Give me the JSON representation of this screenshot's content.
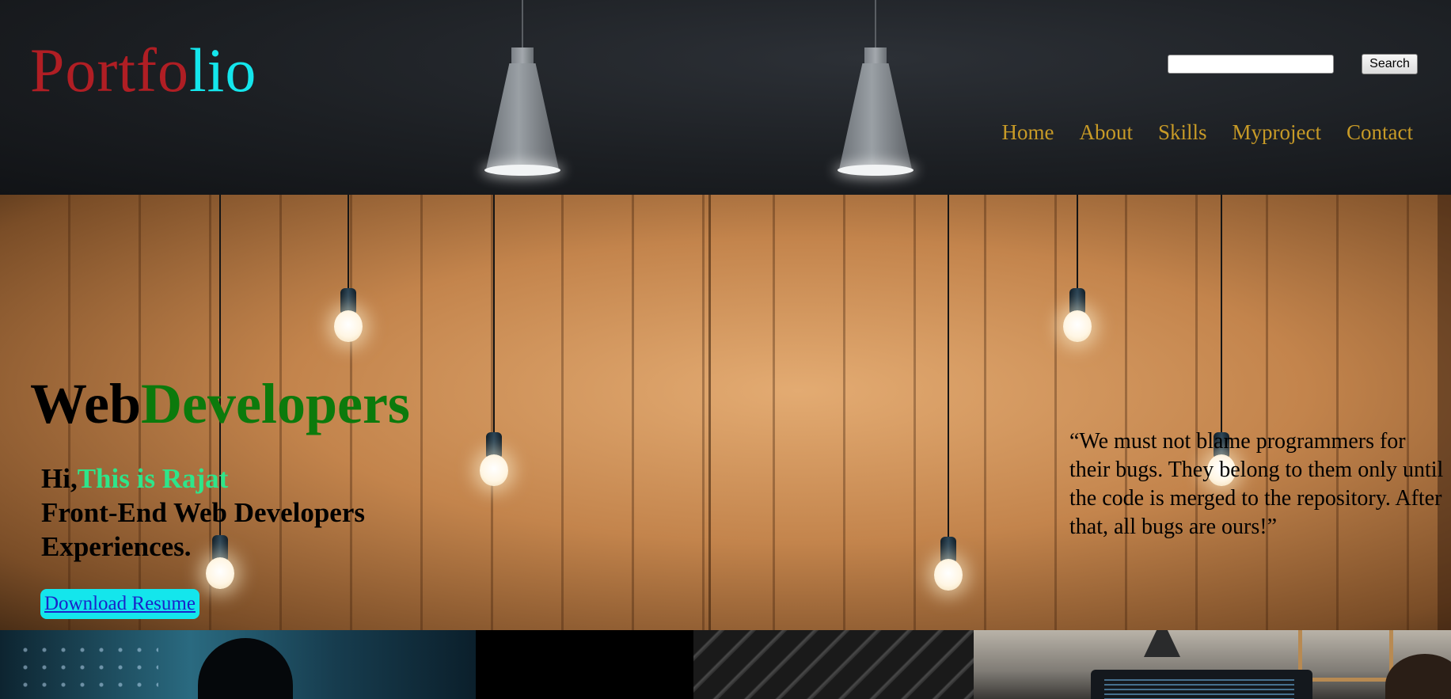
{
  "header": {
    "logo": {
      "part1": "Portfo",
      "part2": "lio"
    },
    "search": {
      "value": "",
      "placeholder": "",
      "button_label": "Search"
    },
    "nav": [
      "Home",
      "About",
      "Skills",
      "Myproject",
      "Contact"
    ]
  },
  "hero": {
    "title": {
      "part1": "Web",
      "part2": "Developers"
    },
    "greeting": "Hi,",
    "name": "This is Rajat",
    "role_line1": "Front-End Web Developers",
    "role_line2": "Experiences.",
    "download_label": "Download Resume",
    "quote": "“We must not blame programmers for their bugs. They belong to them only until the code is merged to the repository. After that, all bugs are ours!”"
  },
  "colors": {
    "logo_red": "#b01e24",
    "logo_cyan": "#14e6ec",
    "nav_gold": "#c79a27",
    "title_green": "#0c7a0c",
    "name_green": "#2ee58a",
    "button_cyan": "#14e6ec"
  }
}
